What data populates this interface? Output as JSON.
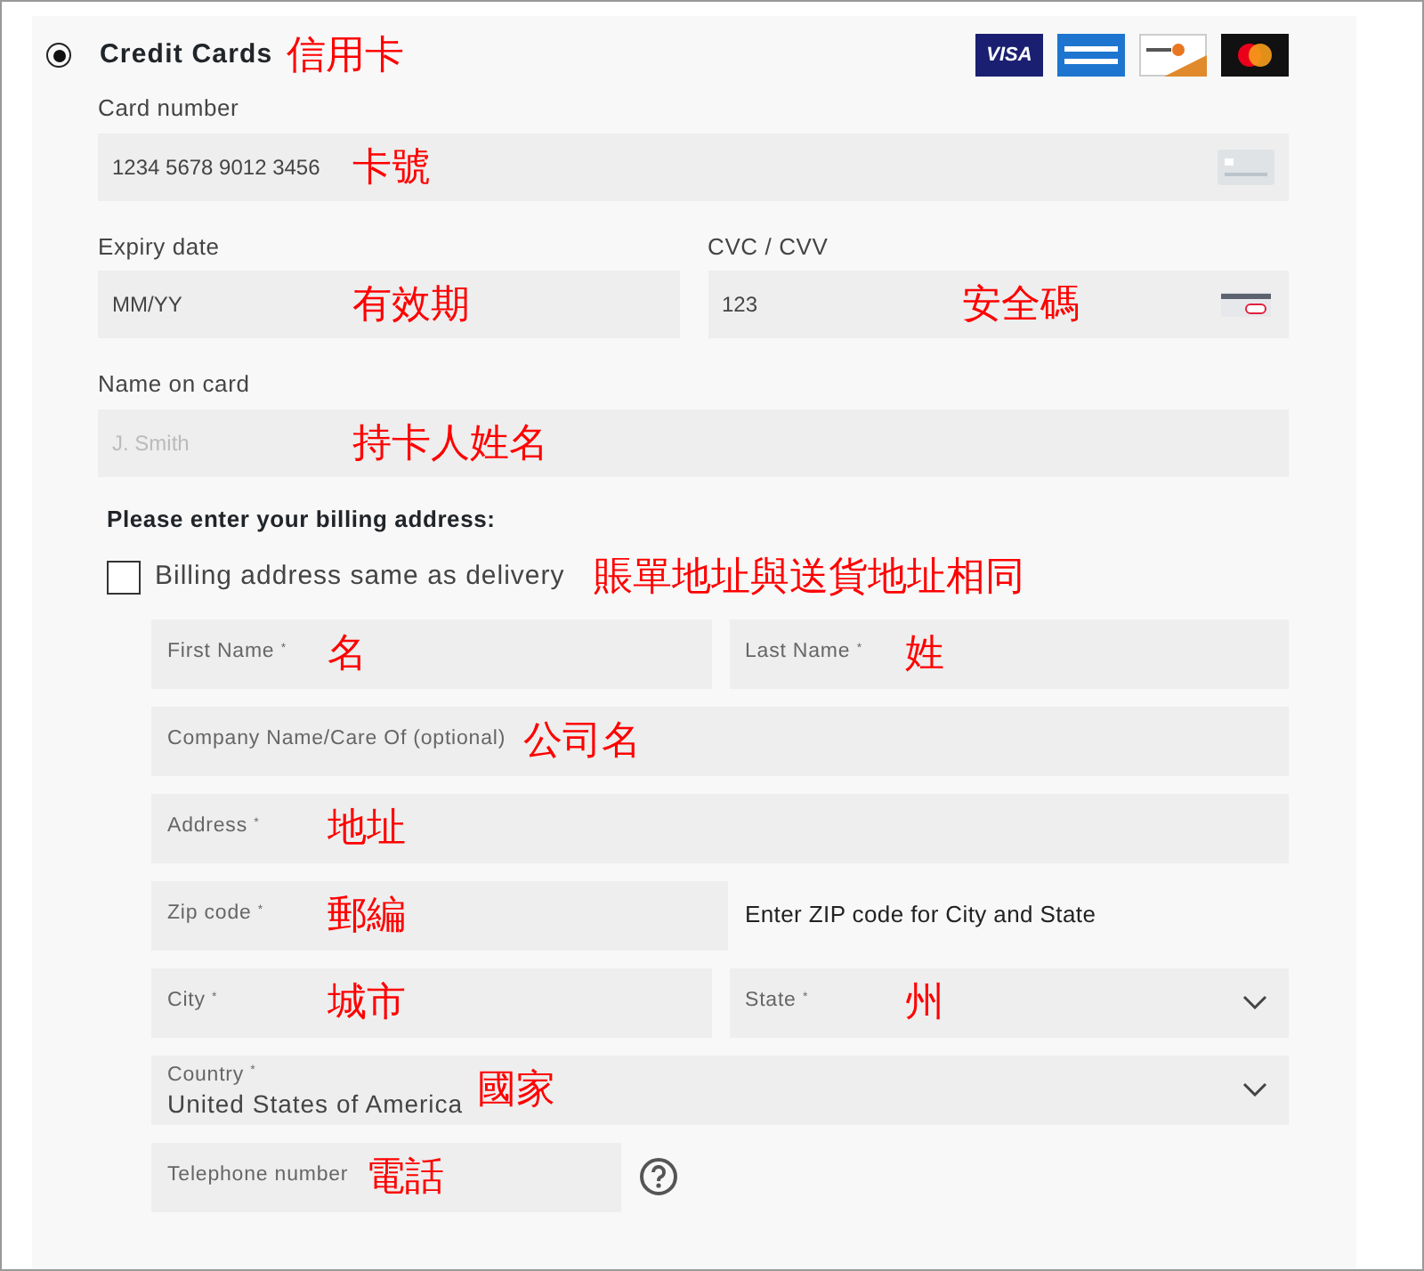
{
  "payment_method": {
    "label": "Credit Cards",
    "annotation": "信用卡",
    "selected": true
  },
  "card_logos": [
    {
      "kind": "visa",
      "label": "VISA"
    },
    {
      "kind": "amex"
    },
    {
      "kind": "discover"
    },
    {
      "kind": "mastercard"
    }
  ],
  "card_fields": [
    {
      "kind": "card",
      "label": "Card number",
      "value": "1234 5678 9012 3456",
      "annotation": "卡號"
    },
    {
      "kind": "plain",
      "label": "Expiry date",
      "value": "MM/YY",
      "annotation": "有效期"
    },
    {
      "kind": "cvc",
      "label": "CVC / CVV",
      "value": "123",
      "annotation": "安全碼"
    },
    {
      "kind": "plain",
      "label": "Name on card",
      "placeholder": "J. Smith",
      "annotation": "持卡人姓名"
    }
  ],
  "billing": {
    "heading": "Please enter your billing address:",
    "same_as_delivery": {
      "label": "Billing address same as delivery",
      "annotation": "賬單地址與送貨地址相同",
      "checked": false
    },
    "rows": [
      [
        {
          "kind": "field",
          "placeholder": "First Name $^{*}$",
          "annotation": "名"
        },
        {
          "kind": "field",
          "placeholder": "Last Name $^{*}$",
          "annotation": "姓"
        }
      ],
      [
        {
          "kind": "field",
          "placeholder": "Company Name/Care Of (optional)",
          "annotation": "公司名"
        }
      ],
      [
        {
          "kind": "field",
          "placeholder": "Address $^{*}$",
          "annotation": "地址"
        }
      ],
      [
        {
          "kind": "field",
          "placeholder": "Zip code $^{*}$",
          "annotation": "郵編"
        },
        {
          "kind": "note",
          "text": "Enter ZIP code for City and State"
        }
      ],
      [
        {
          "kind": "field",
          "placeholder": "City $^{*}$",
          "annotation": "城市"
        },
        {
          "kind": "select",
          "placeholder": "State $^{*}$",
          "annotation": "州"
        }
      ],
      [
        {
          "kind": "select",
          "label": "Country $^{*}$",
          "value": "United States of America",
          "annotation": "國家"
        }
      ],
      [
        {
          "kind": "field",
          "placeholder": "Telephone number",
          "annotation": "電話"
        },
        {
          "kind": "help"
        }
      ]
    ]
  }
}
